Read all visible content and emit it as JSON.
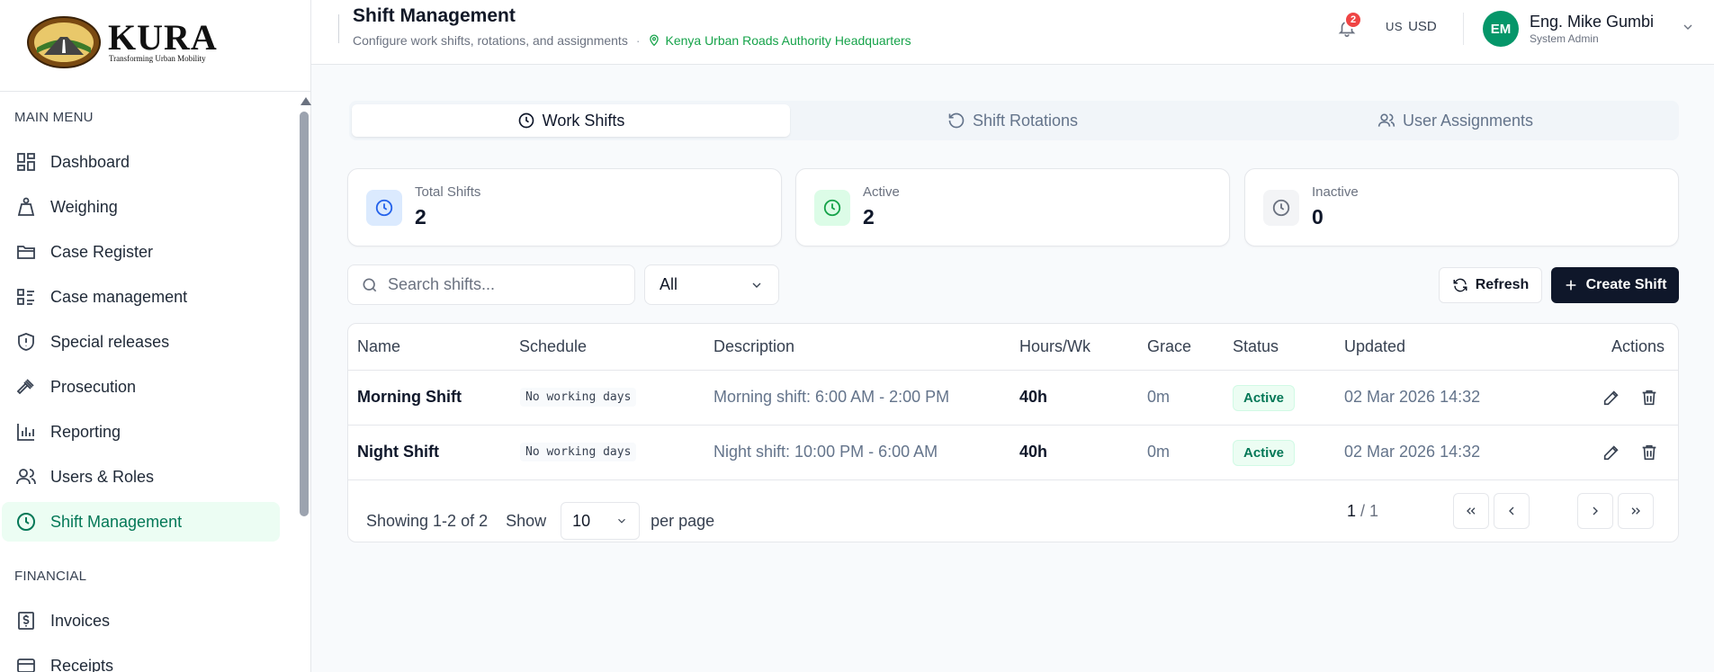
{
  "brand": {
    "name": "KURA",
    "tagline": "Transforming Urban Mobility"
  },
  "header": {
    "title": "Shift Management",
    "subtitle": "Configure work shifts, rotations, and assignments",
    "location": "Kenya Urban Roads Authority Headquarters",
    "notifications": "2",
    "currency_flag": "US",
    "currency": "USD",
    "user": {
      "initials": "EM",
      "name": "Eng. Mike Gumbi",
      "role": "System Admin"
    }
  },
  "sidebar": {
    "sections": [
      {
        "title": "MAIN MENU"
      },
      {
        "title": "FINANCIAL"
      }
    ],
    "items": [
      {
        "label": "Dashboard",
        "icon": "dashboard-icon"
      },
      {
        "label": "Weighing",
        "icon": "weight-icon"
      },
      {
        "label": "Case Register",
        "icon": "folder-icon"
      },
      {
        "label": "Case management",
        "icon": "list-icon"
      },
      {
        "label": "Special releases",
        "icon": "shield-icon"
      },
      {
        "label": "Prosecution",
        "icon": "gavel-icon"
      },
      {
        "label": "Reporting",
        "icon": "bar-chart-icon"
      },
      {
        "label": "Users & Roles",
        "icon": "users-icon"
      },
      {
        "label": "Shift Management",
        "icon": "clock-icon",
        "active": true
      },
      {
        "label": "Invoices",
        "icon": "invoice-icon"
      },
      {
        "label": "Receipts",
        "icon": "receipt-icon"
      }
    ]
  },
  "tabs": [
    {
      "label": "Work Shifts",
      "active": true
    },
    {
      "label": "Shift Rotations"
    },
    {
      "label": "User Assignments"
    }
  ],
  "stats": [
    {
      "label": "Total Shifts",
      "value": "2",
      "color": "#2563eb",
      "bg": "#dbeafe"
    },
    {
      "label": "Active",
      "value": "2",
      "color": "#16a34a",
      "bg": "#dcfce7"
    },
    {
      "label": "Inactive",
      "value": "0",
      "color": "#6b7280",
      "bg": "#f3f4f6"
    }
  ],
  "toolbar": {
    "search_placeholder": "Search shifts...",
    "filter_value": "All",
    "refresh_label": "Refresh",
    "create_label": "Create Shift"
  },
  "table": {
    "columns": [
      "Name",
      "Schedule",
      "Description",
      "Hours/Wk",
      "Grace",
      "Status",
      "Updated",
      "Actions"
    ],
    "rows": [
      {
        "name": "Morning Shift",
        "schedule": "No working days",
        "description": "Morning shift: 6:00 AM - 2:00 PM",
        "hours": "40h",
        "grace": "0m",
        "status": "Active",
        "updated": "02 Mar 2026 14:32"
      },
      {
        "name": "Night Shift",
        "schedule": "No working days",
        "description": "Night shift: 10:00 PM - 6:00 AM",
        "hours": "40h",
        "grace": "0m",
        "status": "Active",
        "updated": "02 Mar 2026 14:32"
      }
    ]
  },
  "pagination": {
    "showing": "Showing 1-2 of 2",
    "show_label": "Show",
    "per_page_value": "10",
    "per_page_label": "per page",
    "current": "1",
    "total": "/ 1"
  }
}
